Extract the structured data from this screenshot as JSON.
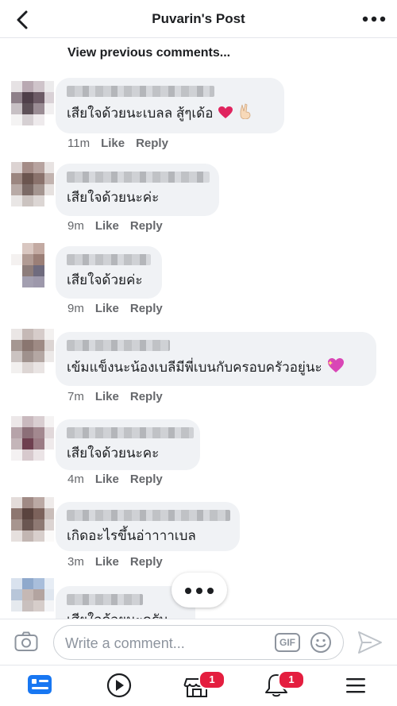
{
  "header": {
    "title": "Puvarin's Post",
    "back_icon": "chevron-left-icon",
    "more_icon": "more-horizontal-icon"
  },
  "view_previous": "View previous comments...",
  "actions": {
    "like": "Like",
    "reply": "Reply"
  },
  "comments": [
    {
      "text": "เสียใจด้วยนะเบลล สู้ๆเด้อ",
      "time": "11m",
      "emoji": [
        "red-heart-icon",
        "victory-hand-icon"
      ]
    },
    {
      "text": "เสียใจด้วยนะค่ะ",
      "time": "9m"
    },
    {
      "text": "เสียใจด้วยค่ะ",
      "time": "9m"
    },
    {
      "text": "เข้มแข็งนะน้องเบลีมีพี่เบนกับครอบครัวอยู่นะ",
      "time": "7m",
      "emoji": [
        "sparkling-heart-icon"
      ]
    },
    {
      "text": "เสียใจด้วยนะคะ",
      "time": "4m"
    },
    {
      "text": "เกิดอะไรขึ้นอ่าาาาเบล",
      "time": "3m"
    },
    {
      "text": "เสียใจด้วยนะครับ"
    }
  ],
  "composer": {
    "placeholder": "Write a comment...",
    "gif_label": "GIF"
  },
  "tabbar": {
    "items": [
      {
        "icon": "news-feed-icon",
        "active": true
      },
      {
        "icon": "watch-video-icon"
      },
      {
        "icon": "marketplace-icon",
        "badge": "1"
      },
      {
        "icon": "notifications-bell-icon",
        "badge": "1"
      },
      {
        "icon": "menu-icon"
      }
    ]
  },
  "colors": {
    "accent": "#1877f2",
    "bubble": "#f0f2f5",
    "meta_text": "#65676b",
    "badge": "#e41e3f"
  }
}
